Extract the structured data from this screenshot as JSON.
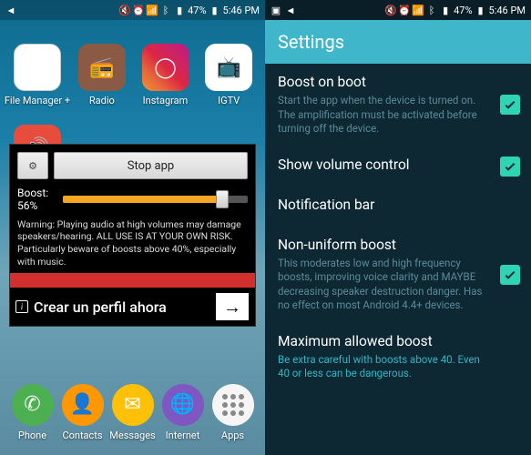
{
  "statusbar": {
    "battery": "47%",
    "time": "5:46 PM"
  },
  "left": {
    "apps": {
      "file_manager": "File Manager\n+",
      "radio": "Radio",
      "instagram": "Instagram",
      "igtv": "IGTV"
    },
    "dialog": {
      "stop_label": "Stop app",
      "boost_label": "Boost:",
      "boost_value": "56%",
      "slider_percent": 86,
      "warning": "Warning: Playing audio at high volumes may damage speakers/hearing. ALL USE IS AT YOUR OWN RISK. Particularly beware of boosts above 40%, especially with music.",
      "ad_text": "Crear un perfil ahora"
    },
    "dock": {
      "phone": "Phone",
      "contacts": "Contacts",
      "messages": "Messages",
      "internet": "Internet",
      "apps": "Apps"
    }
  },
  "right": {
    "header": "Settings",
    "items": [
      {
        "title": "Boost on boot",
        "sub": "Start the app when the device is turned on. The amplification must be activated before turning off the device.",
        "checked": true
      },
      {
        "title": "Show volume control",
        "sub": "",
        "checked": true
      },
      {
        "title": "Notification bar",
        "sub": "",
        "checked": null
      },
      {
        "title": "Non-uniform boost",
        "sub": "This moderates low and high frequency boosts, improving voice clarity and MAYBE decreasing speaker destruction danger. Has no effect on most Android 4.4+ devices.",
        "checked": true
      },
      {
        "title": "Maximum allowed boost",
        "sub": "Be extra careful with boosts above 40. Even 40 or less can be dangerous.",
        "checked": null,
        "accent": true
      }
    ]
  }
}
